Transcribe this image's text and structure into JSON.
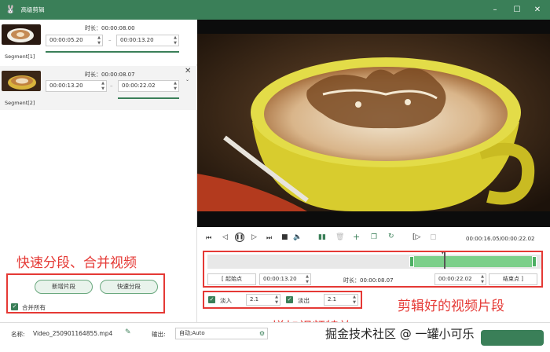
{
  "window": {
    "title": "高级剪辑",
    "logo": "rabbit-logo-icon",
    "min_icon": "–",
    "max_icon": "☐",
    "close_icon": "✕"
  },
  "segments": [
    {
      "label": "Segment[1]",
      "duration": "时长：00:00:08.00",
      "start": "00:00:05.20",
      "end": "00:00:13.20",
      "sep": "–"
    },
    {
      "label": "Segment[2]",
      "duration": "时长：00:00:08.07",
      "start": "00:00:13.20",
      "end": "00:00:22.02",
      "sep": "–"
    }
  ],
  "segment_close": "✕",
  "left_actions": {
    "new_segment": "新增片段",
    "quick_split": "快速分段",
    "merge_all": "合并所有"
  },
  "annotations": {
    "left": "快速分段、合并视频",
    "right": "剪辑好的视频片段",
    "bottom": "增加视频特效"
  },
  "playback": {
    "time": "00:00:16.05/00:00:22.02"
  },
  "trim": {
    "start_btn": "[ 起始点",
    "start": "00:00:13.20",
    "duration": "时长：00:00:08.07",
    "end": "00:00:22.02",
    "end_btn": "结束点 ]"
  },
  "effects": {
    "fade_in_label": "淡入",
    "fade_in": "2.1",
    "fade_out_label": "淡出",
    "fade_out": "2.1"
  },
  "output": {
    "name_label": "名称:",
    "name": "Video_250901164855.mp4",
    "output_label": "输出:",
    "format": "自动;Auto"
  },
  "watermark": "掘金技术社区 @ 一罐小可乐",
  "colors": {
    "accent": "#3a7f58",
    "annotation": "#e53935",
    "video_bg": "#101010"
  }
}
